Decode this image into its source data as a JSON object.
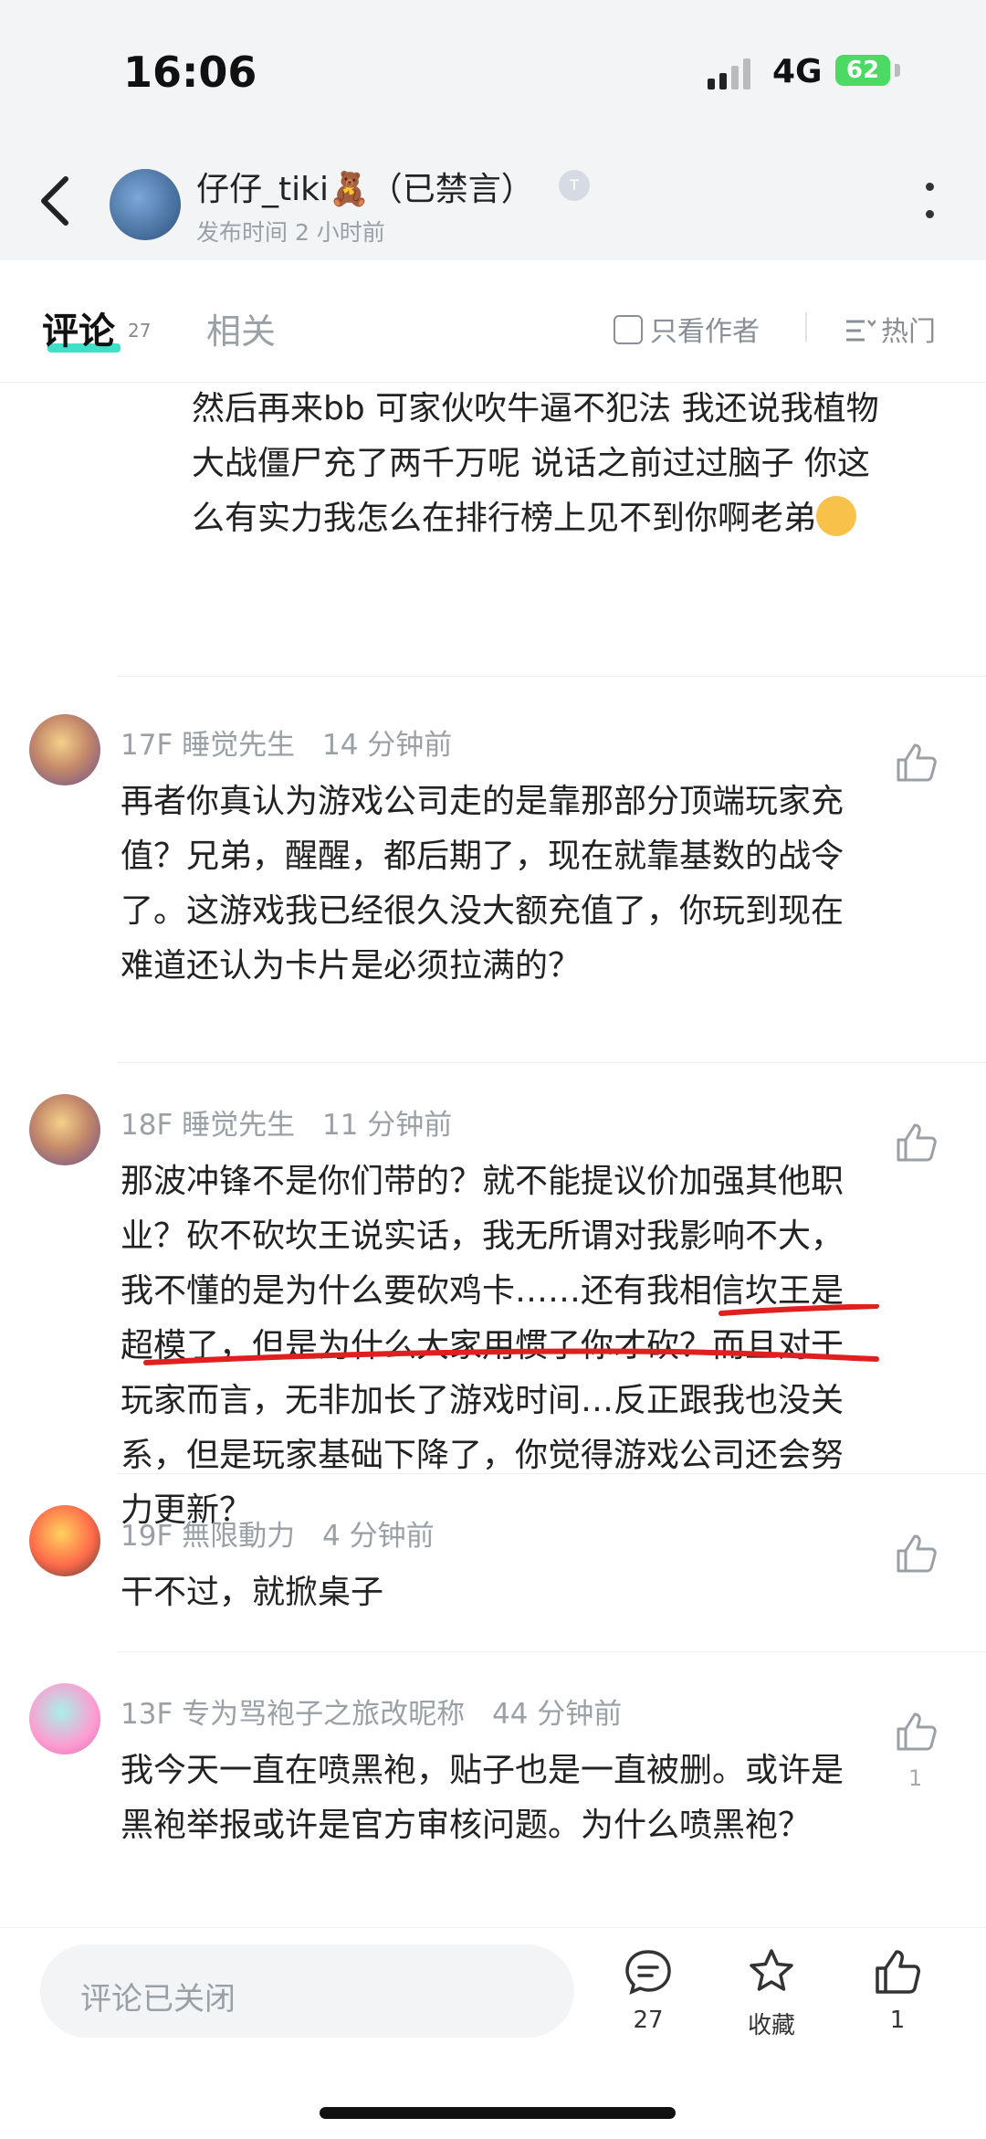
{
  "status": {
    "time": "16:06",
    "network": "4G",
    "battery": "62"
  },
  "post_header": {
    "author": "仔仔_tiki🧸（已禁言）",
    "badge": "T",
    "published": "发布时间 2 小时前"
  },
  "tabs": {
    "comments_label": "评论",
    "comments_count": "27",
    "related_label": "相关",
    "only_author": "只看作者",
    "sort": "热门"
  },
  "previous_comment": {
    "text": "然后再来bb  可家伙吹牛逼不犯法  我还说我植物大战僵尸充了两千万呢  说话之前过过脑子 你这么有实力我怎么在排行榜上见不到你啊老弟"
  },
  "comments": [
    {
      "floor": "17F",
      "user": "睡觉先生",
      "time": "14 分钟前",
      "text": "再者你真认为游戏公司走的是靠那部分顶端玩家充值？兄弟，醒醒，都后期了，现在就靠基数的战令了。这游戏我已经很久没大额充值了，你玩到现在难道还认为卡片是必须拉满的？",
      "likes": ""
    },
    {
      "floor": "18F",
      "user": "睡觉先生",
      "time": "11 分钟前",
      "text": "那波冲锋不是你们带的？就不能提议价加强其他职业？砍不砍坎王说实话，我无所谓对我影响不大，我不懂的是为什么要砍鸡卡……还有我相信坎王是超模了，但是为什么大家用惯了你才砍？而且对于玩家而言，无非加长了游戏时间…反正跟我也没关系，但是玩家基础下降了，你觉得游戏公司还会努力更新？",
      "likes": ""
    },
    {
      "floor": "19F",
      "user": "無限動力",
      "time": "4 分钟前",
      "text": "干不过，就掀桌子",
      "likes": ""
    },
    {
      "floor": "13F",
      "user": "专为骂袍子之旅改昵称",
      "time": "44 分钟前",
      "text": "我今天一直在喷黑袍，贴子也是一直被删。或许是黑袍举报或许是官方审核问题。为什么喷黑袍？",
      "likes": "1"
    }
  ],
  "bottom": {
    "input_placeholder": "评论已关闭",
    "comment_count": "27",
    "favorite_label": "收藏",
    "like_count": "1"
  },
  "colors": {
    "tab_accent": "#3fe0c8",
    "annotation_red": "#e02020",
    "battery": "#4cd964"
  }
}
